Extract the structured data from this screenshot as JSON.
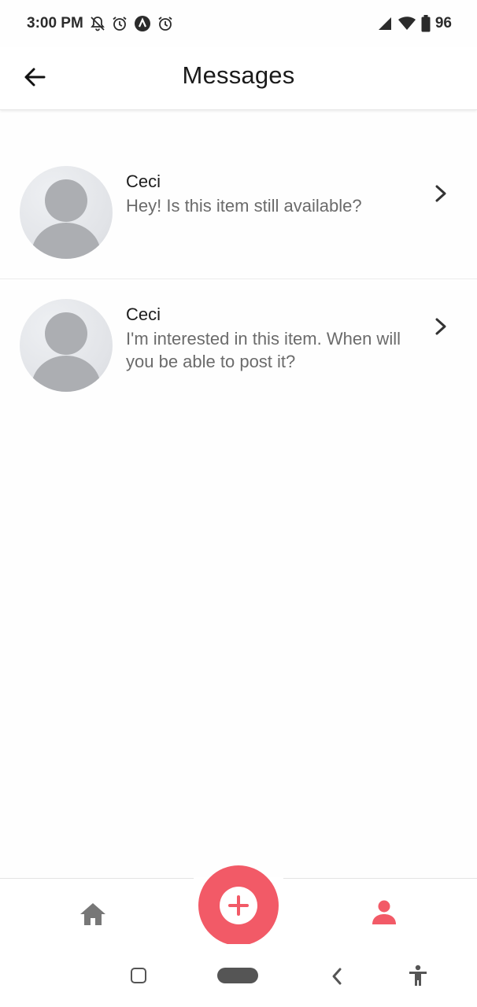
{
  "status_bar": {
    "time": "3:00 PM",
    "battery": "96",
    "icons": [
      "notifications-off-icon",
      "alarm-icon",
      "app-icon",
      "alarm-icon",
      "signal-icon",
      "wifi-icon",
      "battery-icon"
    ]
  },
  "header": {
    "title": "Messages",
    "back_icon": "arrow-left-icon"
  },
  "messages": [
    {
      "sender": "Ceci",
      "preview": "Hey! Is this item still available?"
    },
    {
      "sender": "Ceci",
      "preview": "I'm interested in this item. When will you be able to post it?"
    }
  ],
  "bottom_nav": {
    "items": [
      "home-icon",
      "add-icon",
      "profile-icon"
    ],
    "active": "profile"
  },
  "colors": {
    "accent": "#f25a67",
    "inactive_icon": "#777777",
    "preview_text": "#6b6b6b"
  },
  "system_nav": {
    "buttons": [
      "recents",
      "home",
      "back",
      "accessibility"
    ]
  }
}
